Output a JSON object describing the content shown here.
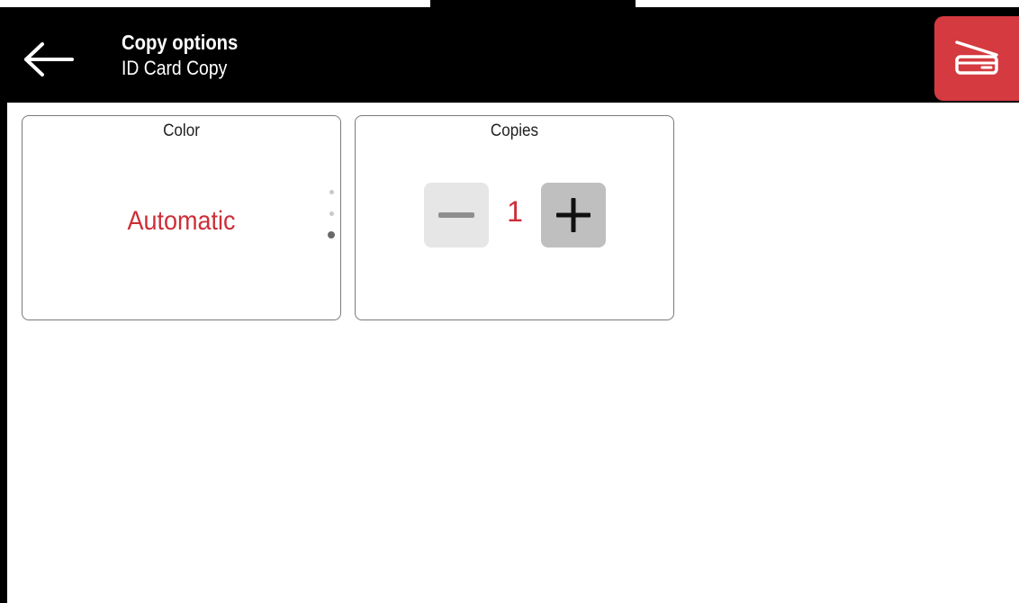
{
  "header": {
    "title": "Copy options",
    "subtitle": "ID Card Copy",
    "back_icon": "arrow-left-icon",
    "scan_icon": "scanner-icon",
    "scan_color": "#d43a40"
  },
  "cards": {
    "color": {
      "title": "Color",
      "value": "Automatic",
      "value_color": "#cc2e38",
      "page_indicator": {
        "total": 3,
        "active": 3
      }
    },
    "copies": {
      "title": "Copies",
      "value": "1",
      "minus_icon": "minus-icon",
      "plus_icon": "plus-icon"
    }
  }
}
